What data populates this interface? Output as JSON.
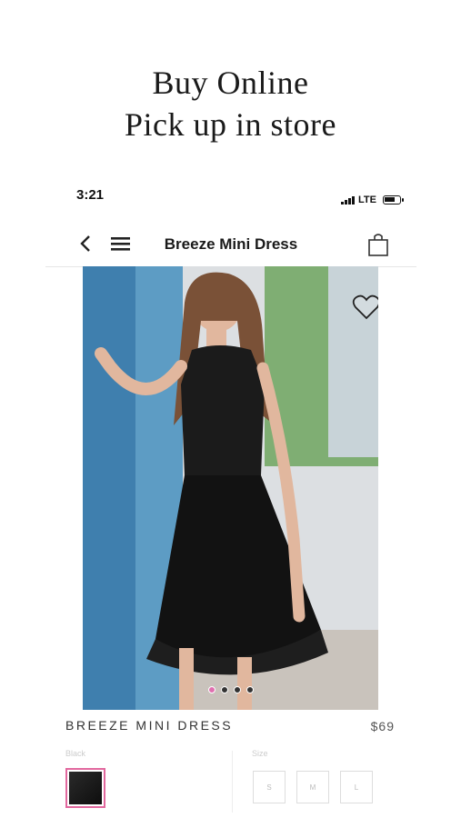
{
  "headline": {
    "line1": "Buy Online",
    "line2": "Pick up in store"
  },
  "status_bar": {
    "time": "3:21",
    "network": "LTE"
  },
  "nav": {
    "title": "Breeze Mini Dress",
    "icons": [
      "back-chevron-icon",
      "hamburger-menu-icon",
      "shopping-bag-icon"
    ]
  },
  "product": {
    "name": "BREEZE MINI DRESS",
    "price": "$69",
    "image_page_index": 1,
    "image_page_count": 4,
    "favorite_icon": "heart-outline-icon"
  },
  "options": {
    "color_label": "Black",
    "size_label": "Size",
    "sizes": [
      "S",
      "M",
      "L"
    ]
  },
  "colors": {
    "accent_pink": "#e2689e",
    "text_dark": "#1a1a1a"
  }
}
